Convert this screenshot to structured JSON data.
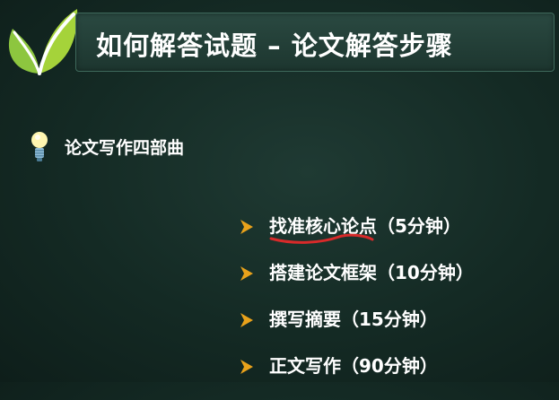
{
  "logo": {
    "icon": "leaf-logo-icon",
    "colors": {
      "leaf_light": "#a5d33a",
      "leaf_dark": "#6aa51c"
    }
  },
  "header": {
    "title": "如何解答试题 – 论文解答步骤"
  },
  "section": {
    "icon": "lightbulb-icon",
    "title": "论文写作四部曲"
  },
  "steps": [
    {
      "icon": "arrow-right-icon",
      "text": "找准核心论点（5分钟）",
      "annotated": true
    },
    {
      "icon": "arrow-right-icon",
      "text": "搭建论文框架（10分钟）"
    },
    {
      "icon": "arrow-right-icon",
      "text": "撰写摘要（15分钟）"
    },
    {
      "icon": "arrow-right-icon",
      "text": "正文写作（90分钟）"
    }
  ],
  "colors": {
    "background": "#142a24",
    "accent_arrow": "#e9a21b",
    "annotation": "#d82a2a",
    "text": "#ffffff"
  }
}
